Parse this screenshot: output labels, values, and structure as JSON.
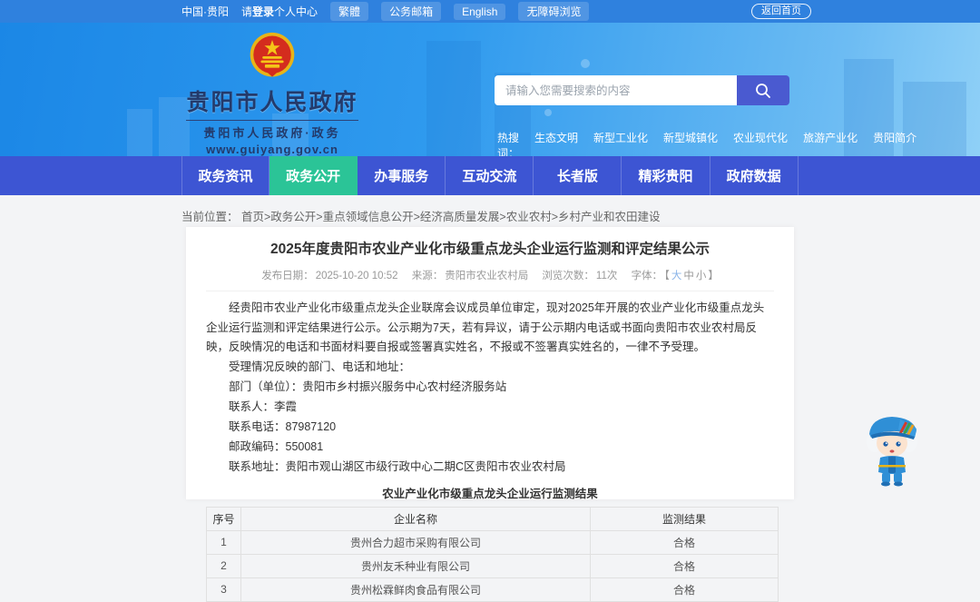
{
  "colors": {
    "topbar_bg": "#2f81de",
    "banner_blue": "#1b87e6",
    "banner_blue_light": "#8fd0f7",
    "nav_bg": "#3d55d3",
    "nav_active_green": "#2bc497",
    "search_button_blue": "#4a5ad0",
    "page_bg": "#f3f4f6"
  },
  "topbar": {
    "region_label": "中国·贵阳",
    "login_prefix": "请",
    "login_bold": "登录",
    "login_suffix": "个人中心",
    "pills": [
      "繁體",
      "公务邮箱",
      "English",
      "无障碍浏览"
    ],
    "home_button": "返回首页"
  },
  "header": {
    "site_name": "贵阳市人民政府",
    "site_subtitle": "贵阳市人民政府·政务",
    "site_url": "www.guiyang.gov.cn",
    "search_placeholder": "请输入您需要搜索的内容",
    "hot_label": "热搜词：",
    "hot_items": [
      "生态文明",
      "新型工业化",
      "新型城镇化",
      "农业现代化",
      "旅游产业化",
      "贵阳简介"
    ]
  },
  "nav": {
    "items": [
      {
        "label": "政务资讯"
      },
      {
        "label": "政务公开"
      },
      {
        "label": "办事服务"
      },
      {
        "label": "互动交流"
      },
      {
        "label": "长者版"
      },
      {
        "label": "精彩贵阳"
      },
      {
        "label": "政府数据"
      }
    ],
    "active_index": 1
  },
  "breadcrumb": {
    "label": "当前位置：",
    "path": "首页>政务公开>重点领域信息公开>经济高质量发展>农业农村>乡村产业和农田建设"
  },
  "article": {
    "title": "2025年度贵阳市农业产业化市级重点龙头企业运行监测和评定结果公示",
    "meta": {
      "publish_label": "发布日期：",
      "publish_date": "2025-10-20 10:52",
      "source_label": "来源：",
      "source": "贵阳市农业农村局",
      "views_label": "浏览次数：",
      "views": "11次",
      "font_label": "字体：",
      "bracket_open": "【",
      "font_large": "大",
      "font_medium": "中",
      "font_small": "小",
      "bracket_close": "】"
    },
    "paragraphs": [
      "经贵阳市农业产业化市级重点龙头企业联席会议成员单位审定，现对2025年开展的农业产业化市级重点龙头企业运行监测和评定结果进行公示。公示期为7天，若有异议，请于公示期内电话或书面向贵阳市农业农村局反映，反映情况的电话和书面材料要自报或签署真实姓名，不报或不签署真实姓名的，一律不予受理。",
      "受理情况反映的部门、电话和地址：",
      "部门（单位）：贵阳市乡村振兴服务中心农村经济服务站",
      "联系人：李霞",
      "联系电话：87987120",
      "邮政编码：550081",
      "联系地址：贵阳市观山湖区市级行政中心二期C区贵阳市农业农村局"
    ],
    "table": {
      "caption": "农业产业化市级重点龙头企业运行监测结果",
      "headers": [
        "序号",
        "企业名称",
        "监测结果"
      ],
      "rows": [
        [
          "1",
          "贵州合力超市采购有限公司",
          "合格"
        ],
        [
          "2",
          "贵州友禾种业有限公司",
          "合格"
        ],
        [
          "3",
          "贵州松霖鲜肉食品有限公司",
          "合格"
        ]
      ]
    }
  }
}
